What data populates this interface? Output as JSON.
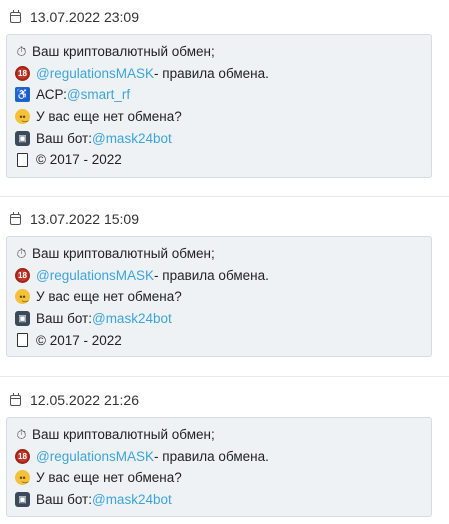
{
  "posts": [
    {
      "date": "13.07.2022 23:09",
      "lines": {
        "exchange": "Ваш криптовалютный обмен;",
        "rules_link": "@regulationsMASK",
        "rules_text": " - правила обмена.",
        "acp_label": "АСР: ",
        "acp_link": "@smart_rf",
        "no_exchange": "У вас еще нет обмена?",
        "bot_label": "Ваш бот: ",
        "bot_link": "@mask24bot",
        "copyright": "© 2017 - 2022"
      }
    },
    {
      "date": "13.07.2022 15:09",
      "lines": {
        "exchange": "Ваш криптовалютный обмен;",
        "rules_link": "@regulationsMASK",
        "rules_text": " - правила обмена.",
        "no_exchange": "У вас еще нет обмена?",
        "bot_label": "Ваш бот: ",
        "bot_link": "@mask24bot",
        "copyright": "© 2017 - 2022"
      }
    },
    {
      "date": "12.05.2022 21:26",
      "lines": {
        "exchange": "Ваш криптовалютный обмен;",
        "rules_link": "@regulationsMASK",
        "rules_text": " - правила обмена.",
        "no_exchange": "У вас еще нет обмена?",
        "bot_label": "Ваш бот: ",
        "bot_link": "@mask24bot"
      }
    }
  ],
  "icons": {
    "clock": "⏱",
    "stop": "18",
    "wheelchair": "♿",
    "face": "•͜•",
    "bot": "▣"
  },
  "colors": {
    "link": "#3da4d9",
    "card_bg": "#eef2f5",
    "card_border": "#d5dde3"
  }
}
